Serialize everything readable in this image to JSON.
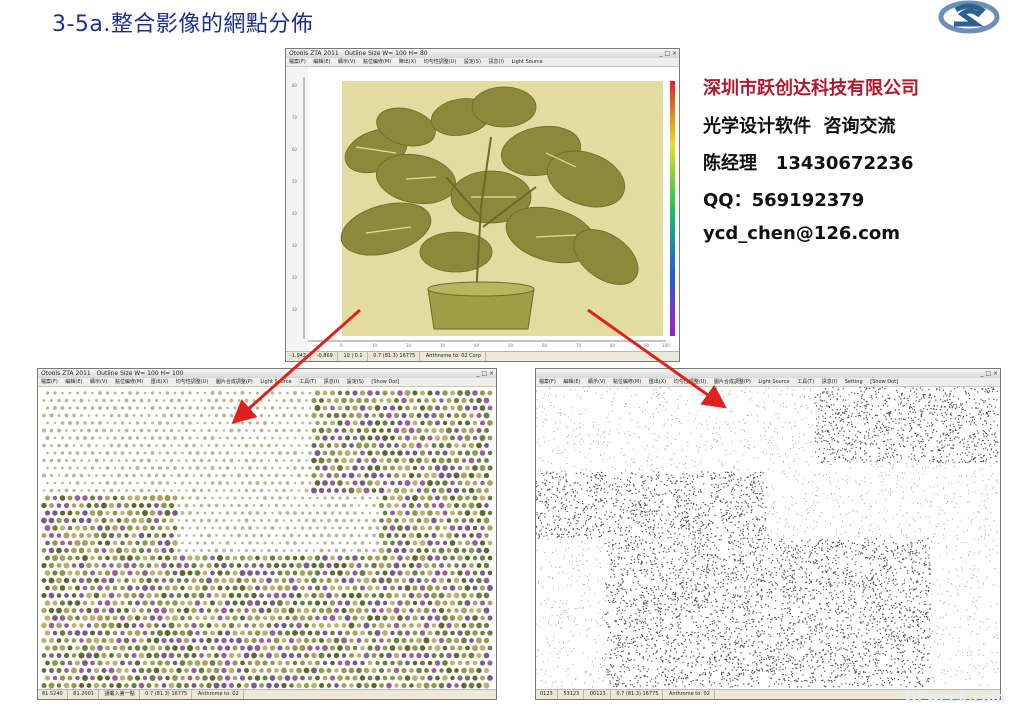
{
  "slide": {
    "title": "3-5a.整合影像的網點分佈"
  },
  "contact": {
    "company": "深圳市跃创达科技有限公司",
    "service": "光学设计软件  咨询交流",
    "manager": "陈经理   13430672236",
    "qq": "QQ：569192379",
    "email": "ycd_chen@126.com"
  },
  "windows": {
    "top": {
      "title": "Otools ZTA 2011",
      "subtitle": "Outline Size  W= 100  H= 80",
      "menu": [
        "檔案(F)",
        "編輯(E)",
        "顯示(V)",
        "點位編修(M)",
        "陣出(X)",
        "均勻性調整(U)",
        "設定(S)",
        "訊息(I)",
        "Light Source"
      ],
      "status": [
        "-1.942",
        "-0.869",
        "10 | 0.1",
        "0.7 (81.3) 16775",
        "Anthnsme to: 02 Corp"
      ]
    },
    "left": {
      "title": "Otools ZTA 2011",
      "subtitle": "Outline Size  W= 100  H= 100",
      "menu": [
        "檔案(F)",
        "編輯(E)",
        "顯示(V)",
        "點位編修(M)",
        "匯出(X)",
        "均勻性調整(U)",
        "圖片合成調整(P)",
        "Light Source",
        "工具(T)",
        "訊息(I)",
        "設定(S)",
        "[Show Dot]"
      ],
      "status": [
        "81.5240",
        "81.2001",
        "請載入第一點",
        "0.7 (81.3) 16775",
        "Anthrome to: 02"
      ]
    },
    "right": {
      "menu": [
        "檔案(F)",
        "編輯(E)",
        "顯示(V)",
        "點位編修(M)",
        "匯出(X)",
        "均勻性調整(U)",
        "圖片合成調整(P)",
        "Light Source",
        "工具(T)",
        "訊息(I)",
        "Setting",
        "[Show Dot]"
      ],
      "status": [
        "0123",
        "53123",
        "00123",
        "0.7 (81.3) 16775",
        "Anthrome to: 02"
      ]
    }
  },
  "watermark": "OFweek.com",
  "colors": {
    "title": "#1c2f8c",
    "company": "#b0192e",
    "arrow": "#e0201e",
    "plant": "#8c8a3a",
    "plant_bg": "#e3dca0"
  }
}
